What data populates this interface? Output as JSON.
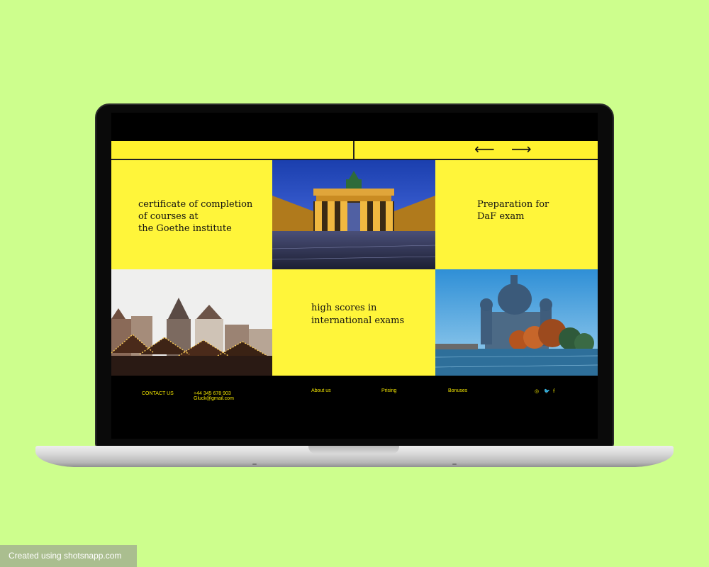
{
  "screen": {
    "nav": {
      "prev_arrow": "⟵",
      "next_arrow": "⟶"
    },
    "tiles": {
      "certificate": [
        "certificate of completion",
        "of courses at",
        "the Goethe institute"
      ],
      "daf_exam": [
        "Preparation for",
        "DaF exam"
      ],
      "high_scores": [
        "high scores in",
        "international exams"
      ]
    },
    "footer": {
      "contact_label": "CONTACT US",
      "phone": "+44 345 678 903",
      "email": "Gluck@gmail.com",
      "links": [
        "About us",
        "Prising",
        "Bonuses"
      ],
      "social": {
        "instagram": "◎",
        "twitter": "🐦",
        "facebook": "f"
      }
    }
  },
  "watermark": "Created using shotsnapp.com",
  "colors": {
    "background": "#cdfe8d",
    "accent_yellow": "#fff53a",
    "footer_text": "#f3e600"
  }
}
